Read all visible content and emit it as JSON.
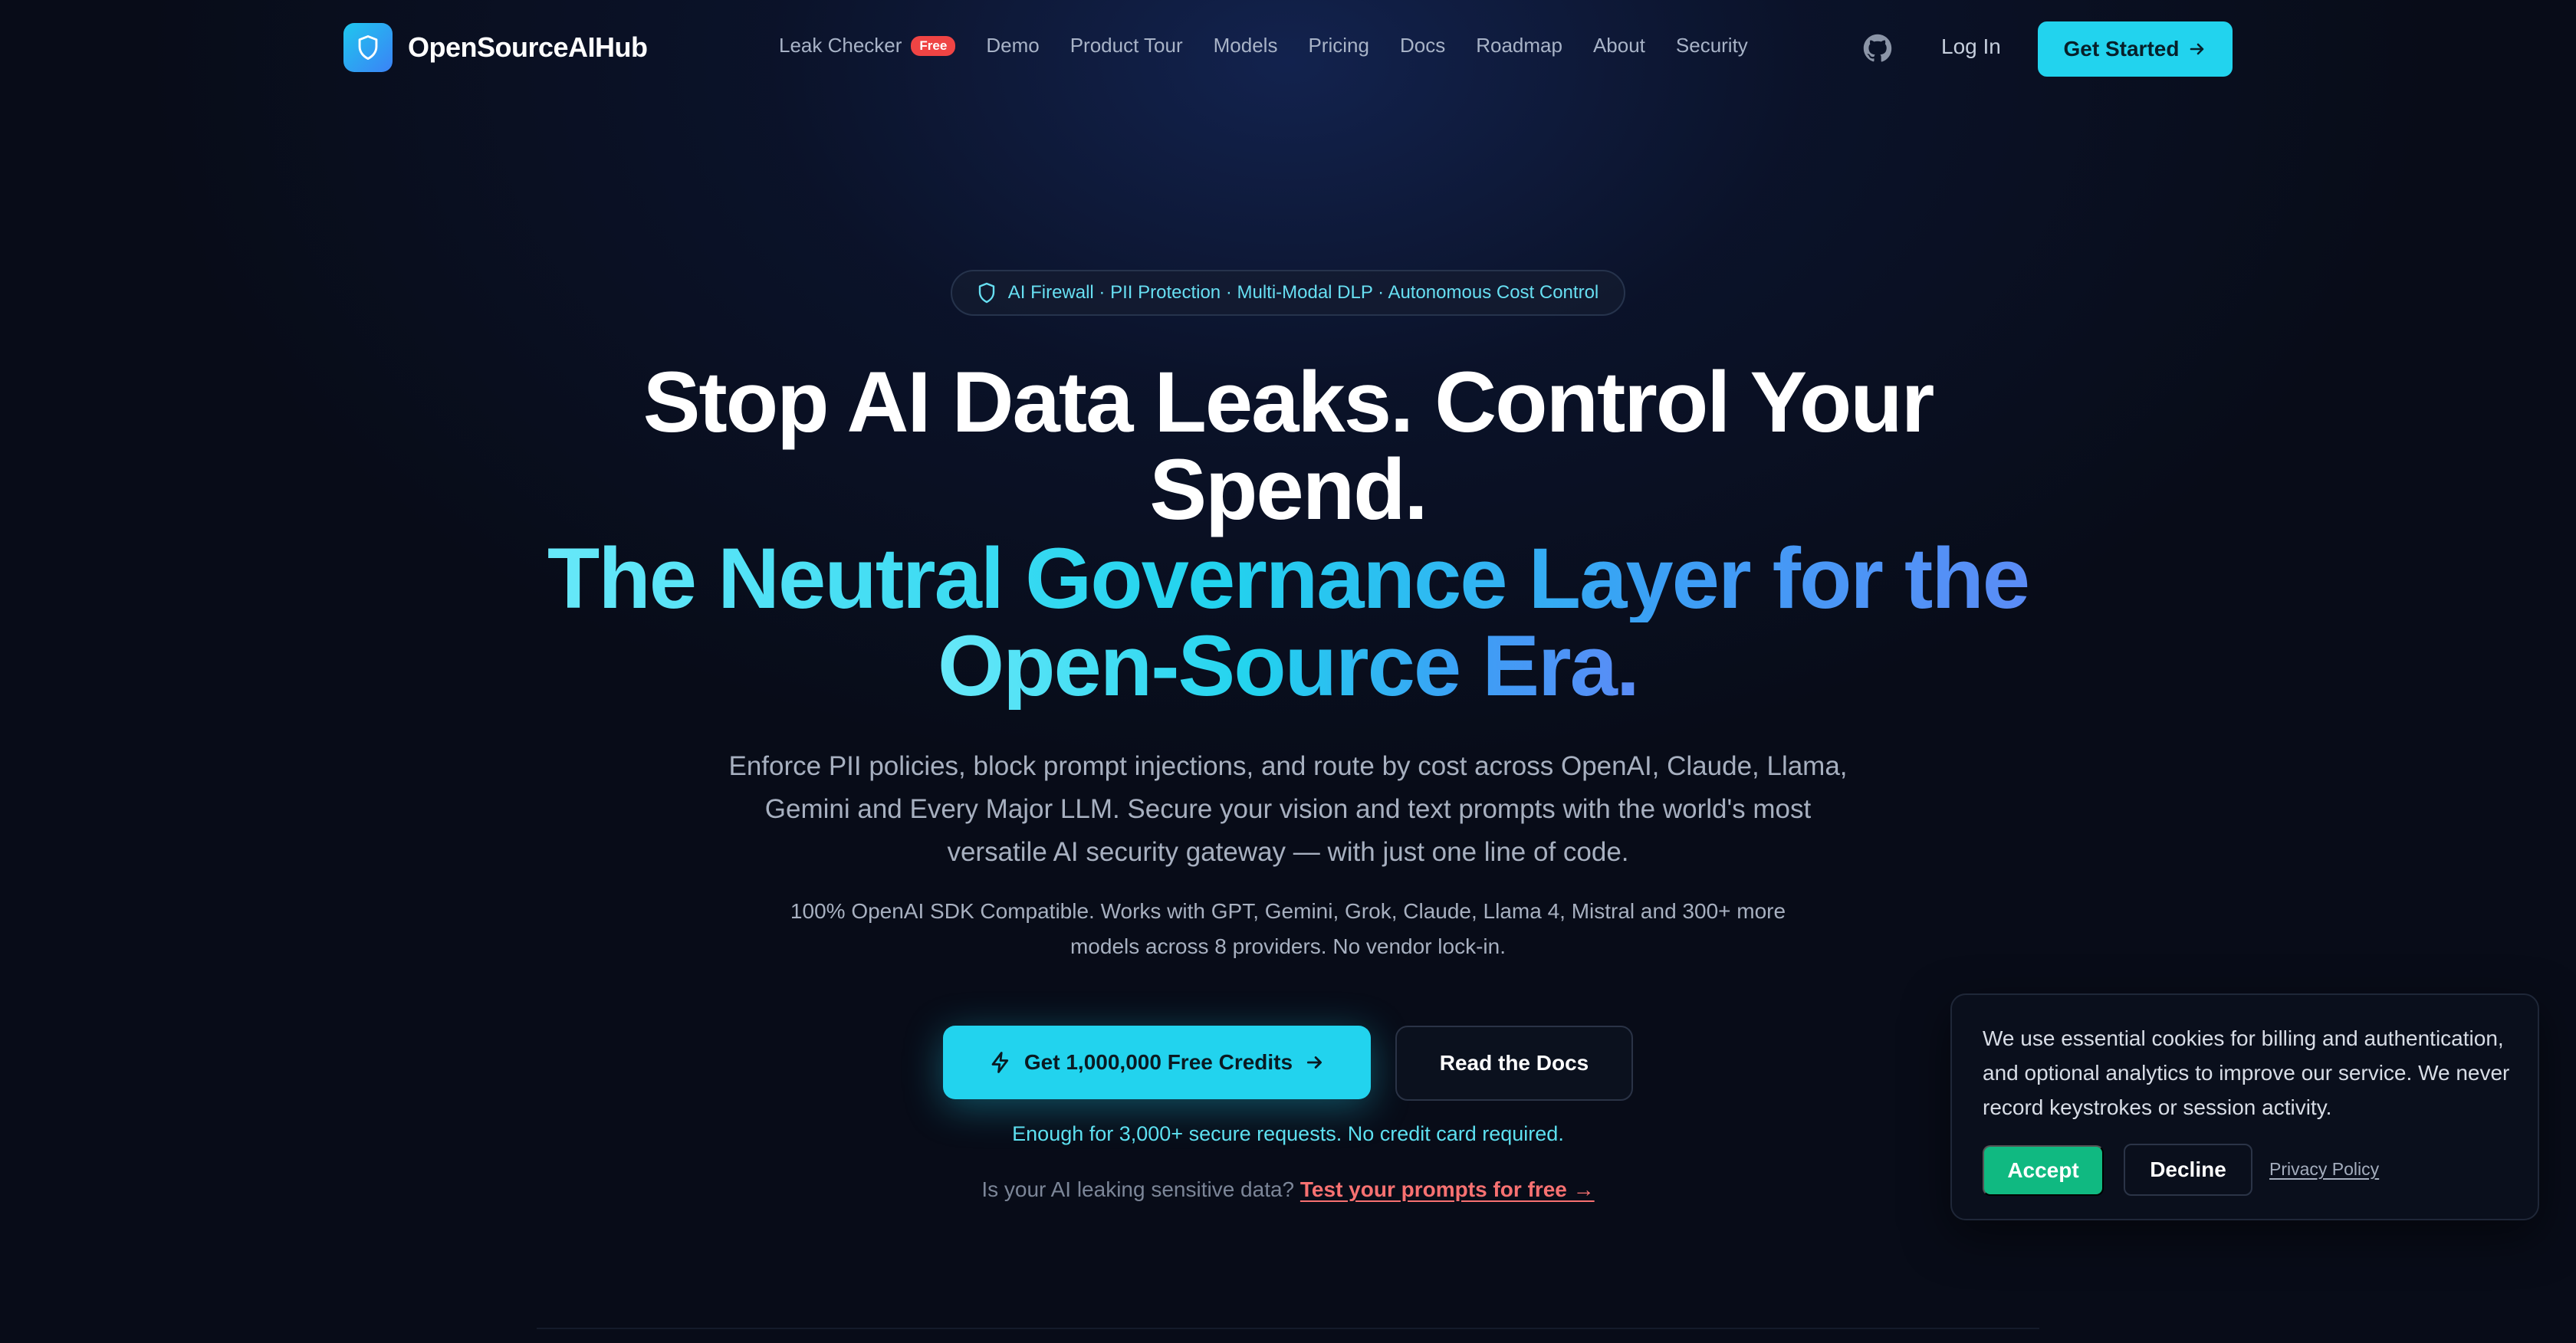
{
  "brand": {
    "name": "OpenSourceAIHub",
    "logo_icon": "shield-icon",
    "accent": "#22d3ee"
  },
  "nav": {
    "items": [
      {
        "label": "Leak Checker",
        "badge": "Free"
      },
      {
        "label": "Demo"
      },
      {
        "label": "Product Tour"
      },
      {
        "label": "Models"
      },
      {
        "label": "Pricing"
      },
      {
        "label": "Docs"
      },
      {
        "label": "Roadmap"
      },
      {
        "label": "About"
      },
      {
        "label": "Security"
      }
    ],
    "github_icon": "github-icon",
    "login_label": "Log In",
    "cta_label": "Get Started"
  },
  "hero": {
    "pill_text": "AI Firewall · PII Protection · Multi-Modal DLP · Autonomous Cost Control",
    "headline_line1": "Stop AI Data Leaks. Control Your",
    "headline_line2": "Spend.",
    "headline_accent_line1": "The Neutral Governance Layer for the",
    "headline_accent_line2": "Open-Source Era.",
    "subtitle_lines": [
      "Enforce PII policies, block prompt injections, and route by cost across OpenAI, Claude, Llama,",
      "Gemini and Every Major LLM. Secure your vision and text prompts with the world's most",
      "versatile AI security gateway — with just one line of code."
    ],
    "compat_lines": [
      "100% OpenAI SDK Compatible. Works with GPT, Gemini, Grok, Claude, Llama 4, Mistral and 300+ more",
      "models across 8 providers. No vendor lock-in."
    ],
    "primary_cta": "Get 1,000,000 Free Credits",
    "secondary_cta": "Read the Docs",
    "credit_note": "Enough for 3,000+ secure requests. No credit card required.",
    "leak_question": "Is your AI leaking sensitive data?",
    "leak_link": "Test your prompts for free →"
  },
  "cookie": {
    "message": "We use essential cookies for billing and authentication, and optional analytics to improve our service. We never record keystrokes or session activity.",
    "accept_label": "Accept",
    "decline_label": "Decline",
    "privacy_label": "Privacy Policy"
  },
  "colors": {
    "background": "#080c18",
    "cyan": "#22d3ee",
    "accept_green": "#10b981",
    "free_badge": "#ef4444",
    "leak_link": "#f87171"
  }
}
